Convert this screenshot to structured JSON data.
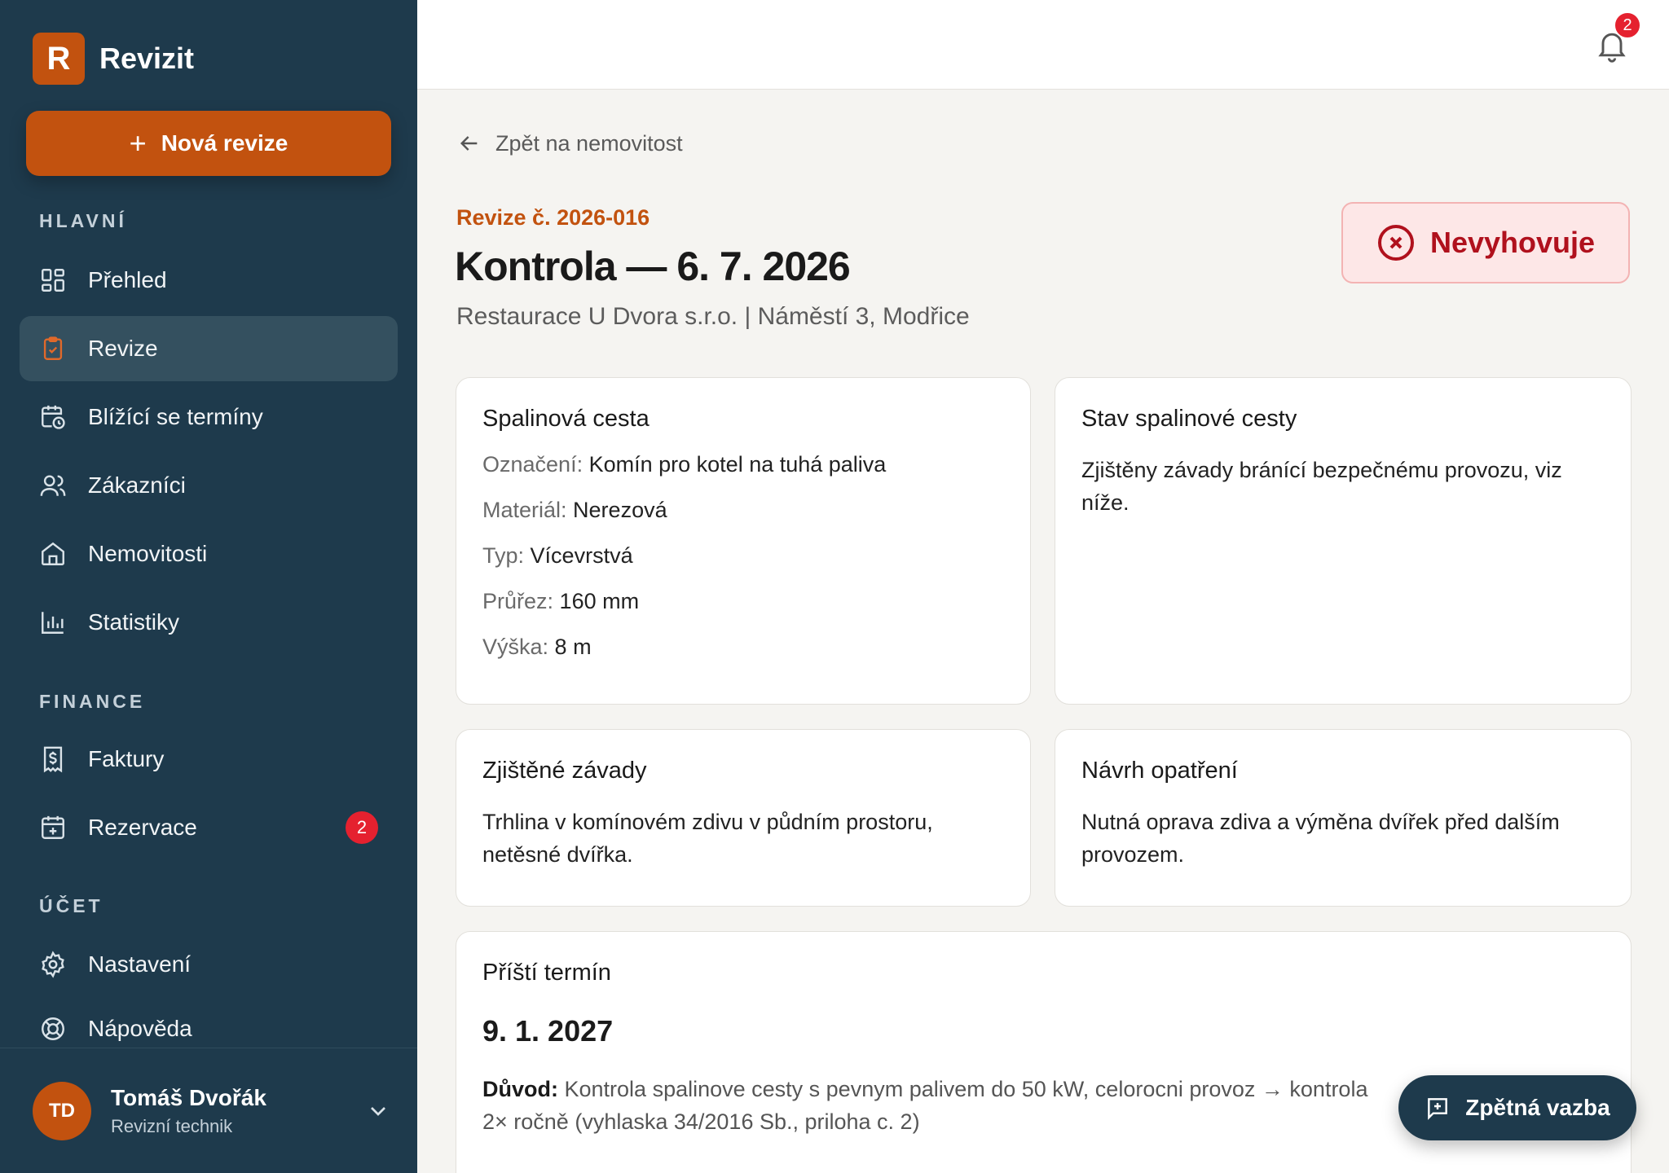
{
  "app": {
    "logo_letter": "R",
    "name": "Revizit"
  },
  "sidebar": {
    "new_button": "Nová revize",
    "sections": {
      "main": "HLAVNÍ",
      "finance": "FINANCE",
      "account": "ÚČET"
    },
    "items": {
      "overview": "Přehled",
      "revisions": "Revize",
      "upcoming": "Blížící se termíny",
      "customers": "Zákazníci",
      "properties": "Nemovitosti",
      "statistics": "Statistiky",
      "invoices": "Faktury",
      "bookings": "Rezervace",
      "bookings_badge": "2",
      "settings": "Nastavení",
      "help": "Nápověda"
    },
    "user": {
      "initials": "TD",
      "name": "Tomáš Dvořák",
      "role": "Revizní technik"
    }
  },
  "topbar": {
    "notifications_count": "2"
  },
  "main": {
    "back_label": "Zpět na nemovitost",
    "revision_number": "Revize č. 2026-016",
    "title": "Kontrola — 6. 7. 2026",
    "subtitle": "Restaurace U Dvora s.r.o. | Náměstí 3, Modřice",
    "status": "Nevyhovuje",
    "flue": {
      "title": "Spalinová cesta",
      "fields": [
        {
          "label": "Označení:",
          "value": "Komín pro kotel na tuhá paliva"
        },
        {
          "label": "Materiál:",
          "value": "Nerezová"
        },
        {
          "label": "Typ:",
          "value": "Vícevrstvá"
        },
        {
          "label": "Průřez:",
          "value": "160 mm"
        },
        {
          "label": "Výška:",
          "value": "8 m"
        }
      ]
    },
    "flue_state": {
      "title": "Stav spalinové cesty",
      "text": "Zjištěny závady bránící bezpečnému provozu, viz níže."
    },
    "defects": {
      "title": "Zjištěné závady",
      "text": "Trhlina v komínovém zdivu v půdním prostoru, netěsné dvířka."
    },
    "measures": {
      "title": "Návrh opatření",
      "text": "Nutná oprava zdiva a výměna dvířek před dalším provozem."
    },
    "next_term": {
      "title": "Příští termín",
      "date": "9. 1. 2027",
      "reason_label": "Důvod:",
      "reason_text": "Kontrola spalinove cesty s pevnym palivem do 50 kW, celorocni provoz → kontrola 2× ročně (vyhlaska 34/2016 Sb., priloha c. 2)"
    }
  },
  "feedback_button": "Zpětná vazba",
  "colors": {
    "sidebar": "#1e3a4c",
    "accent": "#c2520f",
    "danger": "#b0111d",
    "badge": "#e5212f"
  }
}
